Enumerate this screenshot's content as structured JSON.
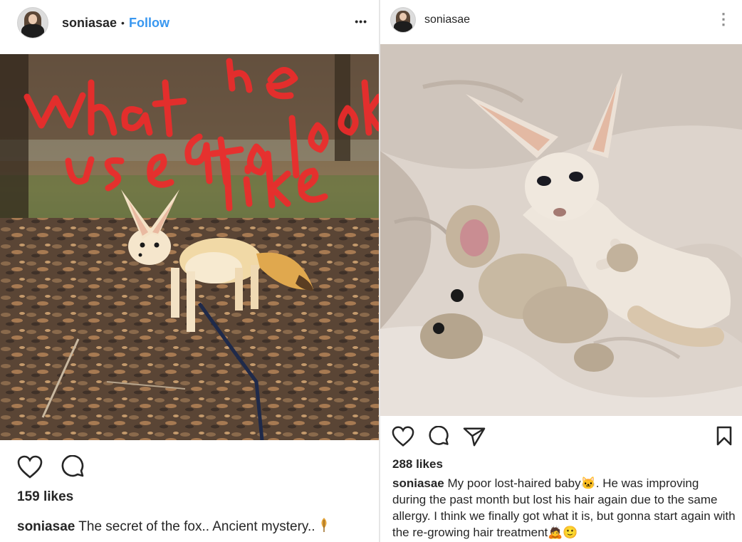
{
  "left_post": {
    "username": "soniasae",
    "separator": "•",
    "follow_label": "Follow",
    "more_label": "•••",
    "overlay_text_lines": [
      "what he",
      "used to look",
      "like"
    ],
    "likes": "159 likes",
    "caption_user": "soniasae",
    "caption_text": "The secret of the fox.. Ancient mystery.."
  },
  "right_post": {
    "username": "soniasae",
    "more_label": "⋮",
    "likes": "288 likes",
    "caption_user": "soniasae",
    "caption_text": "My poor lost-haired baby🐱. He was improving during the past month but lost his hair again due to the same allergy. I think we finally got what it is, but gonna start again with the re-growing hair treatment🙇🙂"
  },
  "icons": {
    "like": "heart-icon",
    "comment": "comment-icon",
    "share": "share-icon",
    "save": "bookmark-icon",
    "more": "more-options-icon",
    "caption_emoji": "leaf-icon"
  },
  "colors": {
    "follow": "#3897f0",
    "overlay_scribble": "#ee2b2b",
    "text": "#262626"
  }
}
